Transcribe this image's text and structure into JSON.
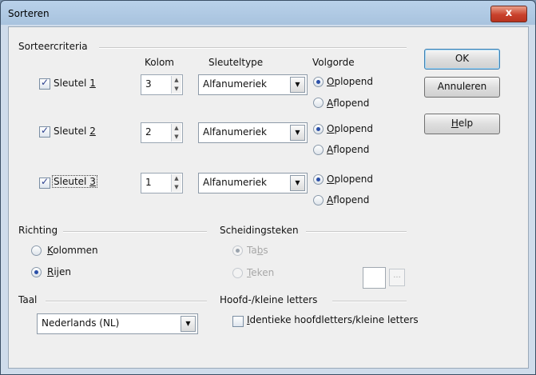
{
  "window": {
    "title": "Sorteren",
    "close_label": "x"
  },
  "criteria": {
    "heading": "Sorteercriteria",
    "col_headers": {
      "kolom": "Kolom",
      "sleuteltype": "Sleuteltype",
      "volgorde": "Volgorde"
    },
    "keys": [
      {
        "label": "Sleutel 1",
        "checked": true,
        "kolom": "3",
        "type": "Alfanumeriek",
        "asc_label": "Oplopend",
        "desc_label": "Aflopend",
        "order": "Oplopend"
      },
      {
        "label": "Sleutel 2",
        "checked": true,
        "kolom": "2",
        "type": "Alfanumeriek",
        "asc_label": "Oplopend",
        "desc_label": "Aflopend",
        "order": "Oplopend"
      },
      {
        "label": "Sleutel 3",
        "checked": true,
        "kolom": "1",
        "type": "Alfanumeriek",
        "asc_label": "Oplopend",
        "desc_label": "Aflopend",
        "order": "Oplopend"
      }
    ]
  },
  "richting": {
    "heading": "Richting",
    "options": [
      "Kolommen",
      "Rijen"
    ],
    "selected": "Rijen"
  },
  "scheidingsteken": {
    "heading": "Scheidingsteken",
    "options": [
      "Tabs",
      "Teken"
    ],
    "selected": "Tabs",
    "more_label": "..."
  },
  "taal": {
    "heading": "Taal",
    "value": "Nederlands (NL)"
  },
  "case": {
    "heading": "Hoofd-/kleine letters",
    "checkbox_label": "Identieke hoofdletters/kleine letters",
    "checked": false
  },
  "buttons": {
    "ok": "OK",
    "cancel": "Annuleren",
    "help": "Help"
  }
}
